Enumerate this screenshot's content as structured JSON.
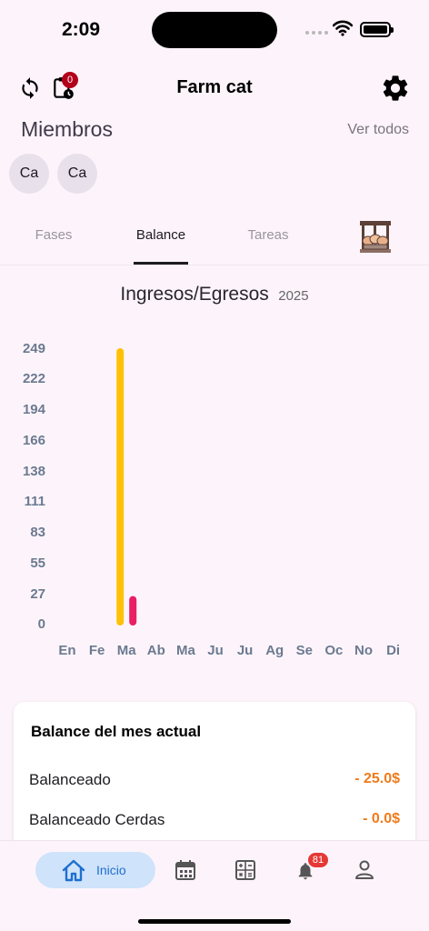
{
  "status": {
    "time": "2:09"
  },
  "appbar": {
    "title": "Farm cat",
    "pending_badge": "0"
  },
  "members": {
    "title": "Miembros",
    "see_all": "Ver todos",
    "avatars": [
      "Ca",
      "Ca"
    ]
  },
  "tabs": [
    {
      "label": "Fases",
      "active": false
    },
    {
      "label": "Balance",
      "active": true
    },
    {
      "label": "Tareas",
      "active": false
    }
  ],
  "chart_data": {
    "type": "bar",
    "title": "Ingresos/Egresos",
    "subtitle": "2025",
    "categories": [
      "En",
      "Fe",
      "Ma",
      "Ab",
      "Ma",
      "Ju",
      "Ju",
      "Ag",
      "Se",
      "Oc",
      "No",
      "Di"
    ],
    "yticks": [
      "0",
      "27",
      "55",
      "83",
      "111",
      "138",
      "166",
      "194",
      "222",
      "249"
    ],
    "ylim": [
      0,
      249
    ],
    "series": [
      {
        "color": "#ffc107",
        "values": [
          0,
          0,
          249,
          0,
          0,
          0,
          0,
          0,
          0,
          0,
          0,
          0
        ]
      },
      {
        "color": "#e91e63",
        "values": [
          0,
          0,
          25,
          0,
          0,
          0,
          0,
          0,
          0,
          0,
          0,
          0
        ]
      }
    ],
    "grid": false,
    "legend": "none"
  },
  "balance_card": {
    "title": "Balance del mes actual",
    "rows": [
      {
        "label": "Balanceado",
        "value": "- 25.0$"
      },
      {
        "label": "Balanceado Cerdas",
        "value": "- 0.0$"
      }
    ]
  },
  "bottom_nav": {
    "home_label": "Inicio",
    "notifications_badge": "81"
  },
  "colors": {
    "accent": "#1f6fd0",
    "negative": "#f07a1a",
    "income": "#ffc107",
    "expense": "#e91e63"
  }
}
